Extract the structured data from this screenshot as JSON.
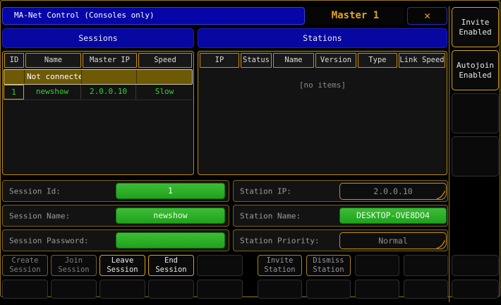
{
  "window": {
    "title": "MA-Net Control (Consoles only)",
    "session_badge": "Master 1",
    "close_glyph": "✕"
  },
  "sessions": {
    "title": "Sessions",
    "columns": [
      "ID",
      "Name",
      "Master IP",
      "Speed"
    ],
    "selected_row": {
      "id": "",
      "name": "Not connecte",
      "master_ip": "",
      "speed": ""
    },
    "row": {
      "id": "1",
      "name": "newshow",
      "master_ip": "2.0.0.10",
      "speed": "Slow"
    }
  },
  "stations": {
    "title": "Stations",
    "columns": [
      "IP",
      "Status",
      "Name",
      "Version",
      "Type",
      "Link Speed"
    ],
    "empty_text": "[no items]"
  },
  "form": {
    "session_id": {
      "label": "Session Id:",
      "value": "1"
    },
    "session_name": {
      "label": "Session Name:",
      "value": "newshow"
    },
    "session_password": {
      "label": "Session Password:",
      "value": ""
    },
    "station_ip": {
      "label": "Station IP:",
      "value": "2.0.0.10"
    },
    "station_name": {
      "label": "Station Name:",
      "value": "DESKTOP-OVE8DO4"
    },
    "station_priority": {
      "label": "Station Priority:",
      "value": "Normal"
    }
  },
  "footer": {
    "left": [
      [
        "Create Session",
        "Join Session",
        "Leave Session",
        "End Session",
        ""
      ],
      [
        "",
        "",
        "",
        "",
        ""
      ]
    ],
    "right": [
      [
        "Invite Station",
        "Dismiss Station",
        "",
        ""
      ],
      [
        "",
        "",
        "",
        ""
      ]
    ]
  },
  "sidebar": {
    "buttons": [
      "Invite Enabled",
      "Autojoin Enabled",
      "",
      ""
    ],
    "footer_buttons": [
      "",
      ""
    ]
  },
  "colors": {
    "accent_gold": "#d8a41c",
    "title_blue": "#0505a8",
    "field_green": "#2fae2a",
    "row_selected_olive": "#6e5906",
    "value_green_text": "#2ed52e"
  }
}
